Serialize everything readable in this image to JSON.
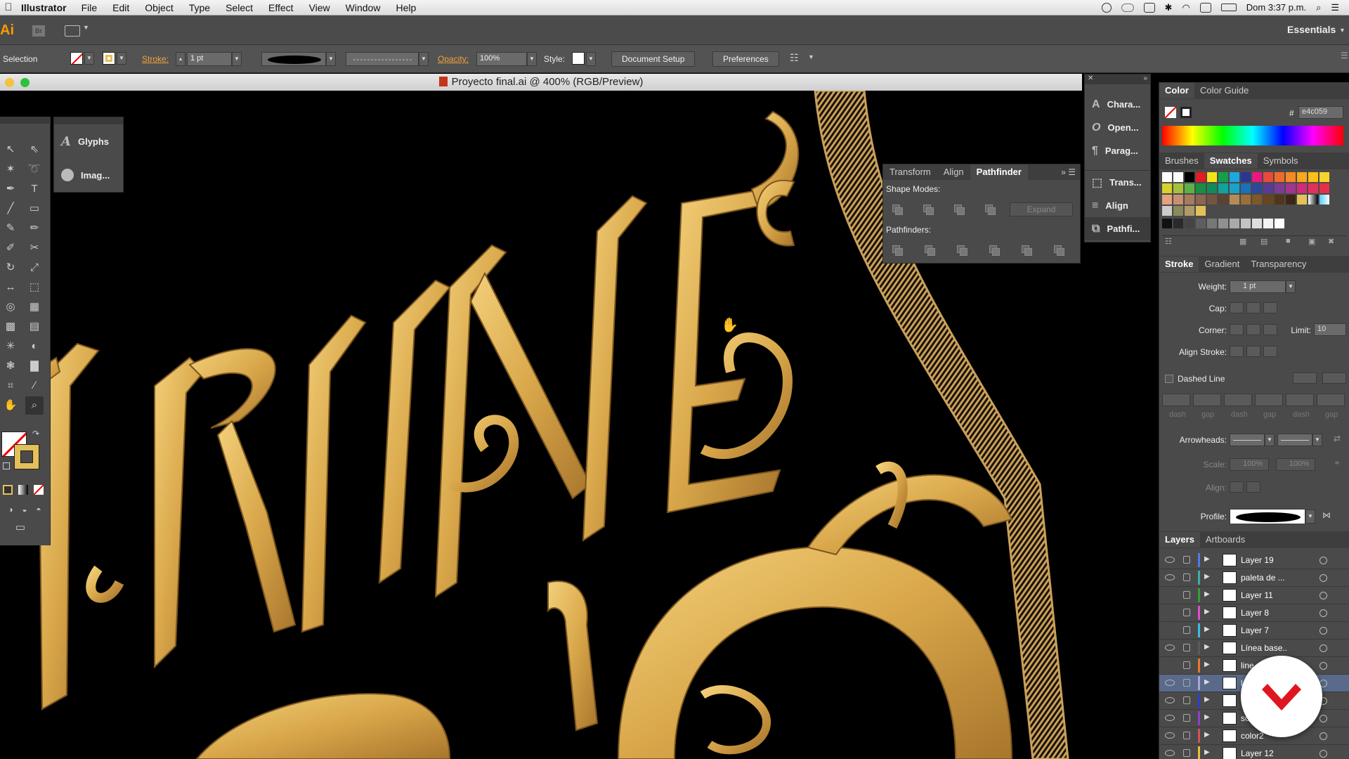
{
  "menubar": {
    "app": "Illustrator",
    "items": [
      "File",
      "Edit",
      "Object",
      "Type",
      "Select",
      "Effect",
      "View",
      "Window",
      "Help"
    ],
    "clock": "Dom 3:37 p.m."
  },
  "appbar": {
    "logo": "Ai",
    "bridge": "Br",
    "workspace": "Essentials"
  },
  "control": {
    "tool_name": "Selection",
    "stroke_label": "Stroke:",
    "stroke_weight": "1 pt",
    "opacity_label": "Opacity:",
    "opacity_value": "100%",
    "style_label": "Style:",
    "doc_setup": "Document Setup",
    "preferences": "Preferences"
  },
  "document": {
    "title": "Proyecto final.ai @ 400% (RGB/Preview)"
  },
  "glyphs_panel": {
    "items": [
      "Glyphs",
      "Imag..."
    ]
  },
  "dock": {
    "items": [
      "Chara...",
      "Open...",
      "Parag...",
      "Trans...",
      "Align",
      "Pathfi..."
    ]
  },
  "pathfinder": {
    "tabs": [
      "Transform",
      "Align",
      "Pathfinder"
    ],
    "shape_modes": "Shape Modes:",
    "pathfinders": "Pathfinders:",
    "expand": "Expand"
  },
  "color_panel": {
    "tabs": [
      "Color",
      "Color Guide"
    ],
    "hash": "#",
    "hex": "e4c059"
  },
  "swatches_panel": {
    "tabs": [
      "Brushes",
      "Swatches",
      "Symbols"
    ]
  },
  "stroke_panel": {
    "tabs": [
      "Stroke",
      "Gradient",
      "Transparency"
    ],
    "weight_label": "Weight:",
    "weight_value": "1 pt",
    "cap_label": "Cap:",
    "corner_label": "Corner:",
    "limit_label": "Limit:",
    "limit_value": "10",
    "align_label": "Align Stroke:",
    "dashed_label": "Dashed Line",
    "dash_labels": [
      "dash",
      "gap",
      "dash",
      "gap",
      "dash",
      "gap"
    ],
    "arrowheads_label": "Arrowheads:",
    "scale_label": "Scale:",
    "scale_value1": "100%",
    "scale_value2": "100%",
    "align_arrow_label": "Align:",
    "profile_label": "Profile:"
  },
  "layers_panel": {
    "tabs": [
      "Layers",
      "Artboards"
    ],
    "rows": [
      {
        "name": "Layer 19",
        "color": "#4f7ae8",
        "eye": true
      },
      {
        "name": "paleta de ...",
        "color": "#3bb0a0",
        "eye": true
      },
      {
        "name": "Layer 11",
        "color": "#3a9b3a",
        "eye": false
      },
      {
        "name": "Layer 8",
        "color": "#e04dd0",
        "eye": false
      },
      {
        "name": "Layer 7",
        "color": "#38c0e0",
        "eye": false
      },
      {
        "name": "Línea base..",
        "color": "#5a5a5a",
        "eye": true
      },
      {
        "name": "line",
        "color": "#e87a2a",
        "eye": false
      },
      {
        "name": "l",
        "color": "#a8a8d8",
        "eye": true
      },
      {
        "name": "lo",
        "color": "#2f3fd0",
        "eye": true
      },
      {
        "name": "so",
        "color": "#8f3fd0",
        "eye": true
      },
      {
        "name": "color2",
        "color": "#d84f5a",
        "eye": true
      },
      {
        "name": "Layer 12",
        "color": "#e8c030",
        "eye": true
      }
    ]
  },
  "colors": {
    "gold": "#e4c059",
    "accent": "#f2a23a",
    "logo_red": "#e0161e"
  }
}
